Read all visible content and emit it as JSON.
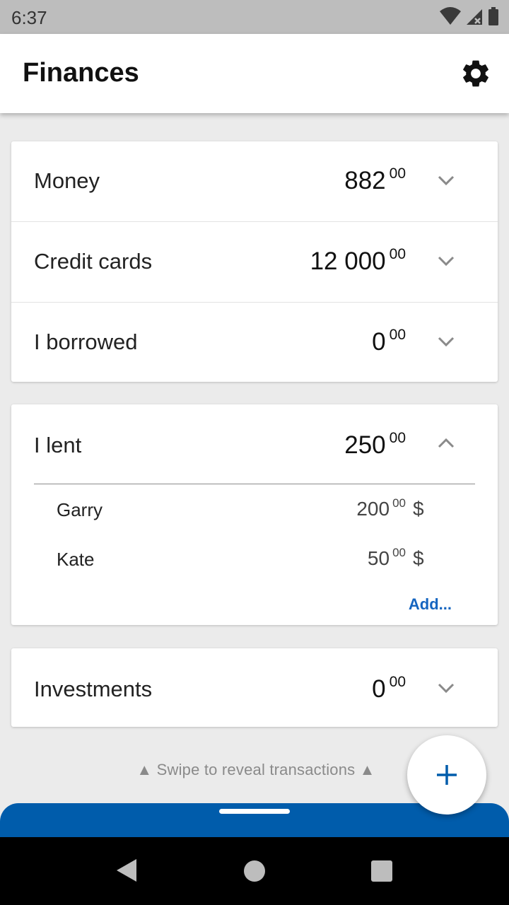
{
  "status_bar": {
    "time": "6:37"
  },
  "app_bar": {
    "title": "Finances"
  },
  "accounts": [
    {
      "label": "Money",
      "whole": "882",
      "cents": "00"
    },
    {
      "label": "Credit cards",
      "whole": "12 000",
      "cents": "00"
    },
    {
      "label": "I borrowed",
      "whole": "0",
      "cents": "00"
    }
  ],
  "lent": {
    "label": "I lent",
    "whole": "250",
    "cents": "00",
    "entries": [
      {
        "name": "Garry",
        "whole": "200",
        "cents": "00",
        "currency": "$"
      },
      {
        "name": "Kate",
        "whole": "50",
        "cents": "00",
        "currency": "$"
      }
    ],
    "add_label": "Add..."
  },
  "investments": {
    "label": "Investments",
    "whole": "0",
    "cents": "00"
  },
  "swipe_hint": "▲ Swipe to reveal transactions ▲",
  "colors": {
    "accent": "#005cab",
    "link": "#1565c0"
  }
}
